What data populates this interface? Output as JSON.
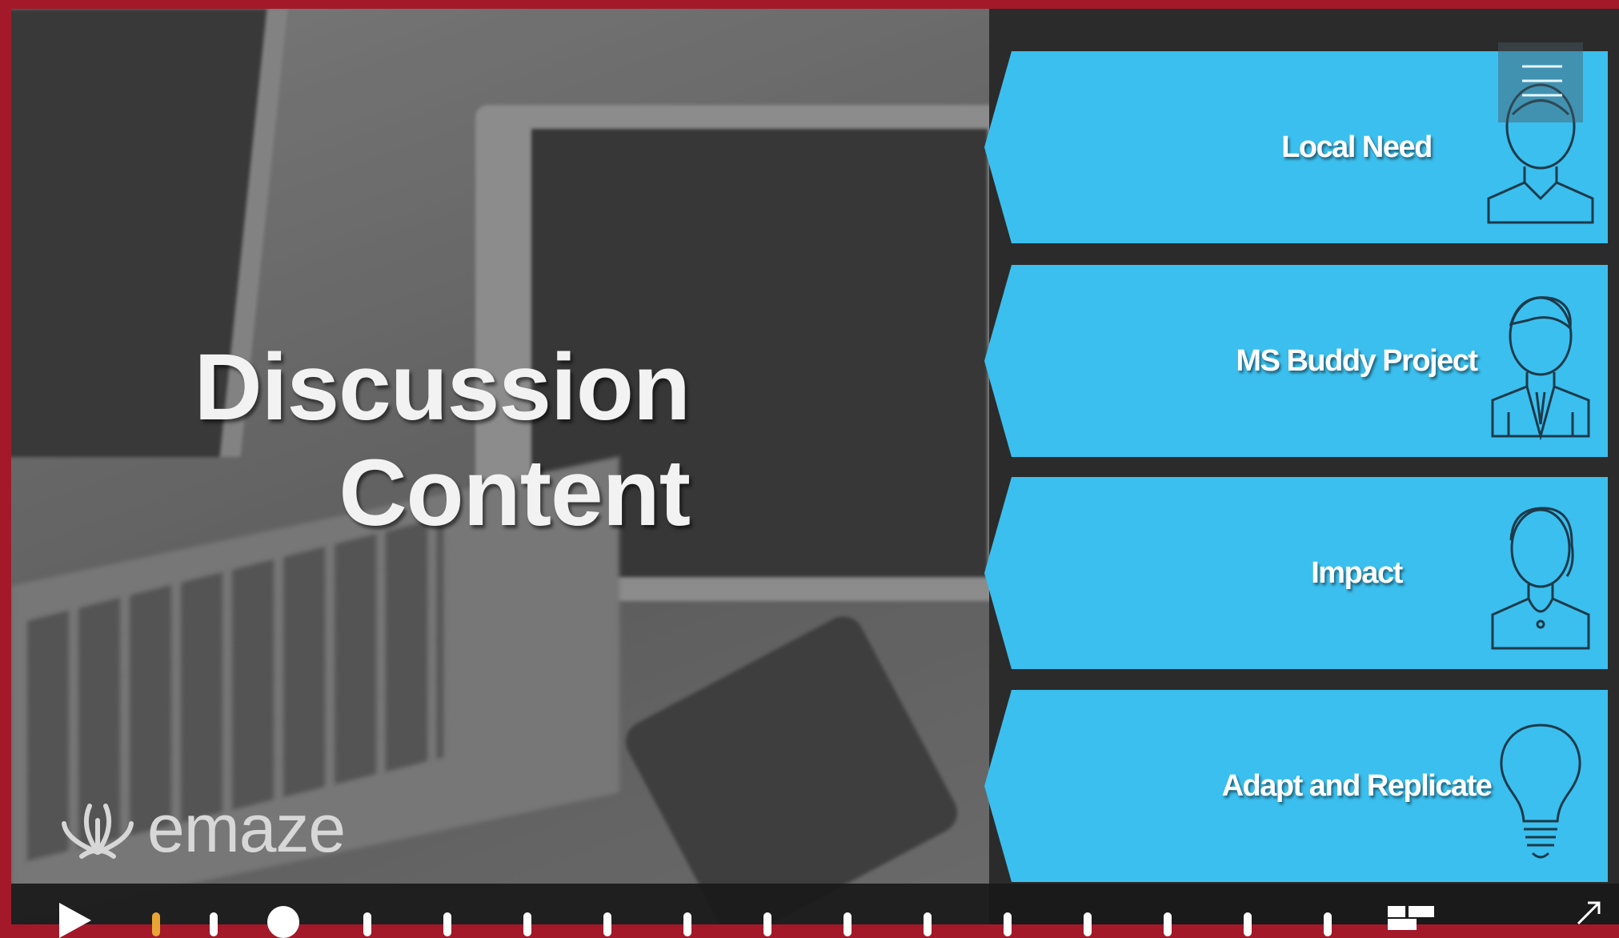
{
  "slide": {
    "title_line1": "Discussion",
    "title_line2": "Content"
  },
  "branding": {
    "logo_text": "emaze",
    "logo_icon": "emaze-flower-icon"
  },
  "menu": {
    "items": [
      {
        "label": "Local Need",
        "icon": "person-icon"
      },
      {
        "label": "MS Buddy Project",
        "icon": "businessman-icon"
      },
      {
        "label": "Impact",
        "icon": "woman-icon"
      },
      {
        "label": "Adapt and Replicate",
        "icon": "lightbulb-icon"
      }
    ]
  },
  "player": {
    "controls": [
      "play-icon",
      "timeline",
      "thumbnails-icon",
      "fullscreen-icon"
    ]
  },
  "colors": {
    "accent": "#3bbfee",
    "frame": "#a3192a",
    "panel": "#2b2b2b",
    "progress_marker": "#e8a534"
  }
}
